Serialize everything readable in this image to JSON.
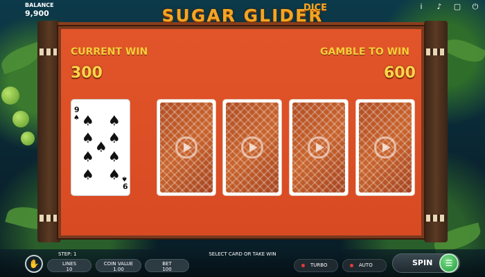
{
  "title": {
    "main": "SUGAR GLIDER",
    "sub": "DICE"
  },
  "balance": {
    "label": "BALANCE",
    "value": "9,900"
  },
  "top_icons": [
    "info-icon",
    "sound-icon",
    "fullscreen-icon",
    "power-icon"
  ],
  "gamble": {
    "current_win_label": "CURRENT WIN",
    "current_win_value": "300",
    "gamble_to_win_label": "GAMBLE TO WIN",
    "gamble_to_win_value": "600",
    "dealer_card": {
      "rank": "9",
      "suit": "spades"
    },
    "hidden_cards": 4
  },
  "bottom": {
    "step_label": "STEP: 1",
    "hint": "SELECT CARD OR TAKE WIN",
    "lines": {
      "label": "LINES",
      "value": "10"
    },
    "coin_value": {
      "label": "COIN VALUE",
      "value": "1.00"
    },
    "bet": {
      "label": "BET",
      "value": "100"
    },
    "turbo_label": "TURBO",
    "auto_label": "AUTO",
    "spin_label": "SPIN"
  },
  "colors": {
    "board": "#e2552a",
    "title": "#f3a623",
    "win_numbers": "#ffd54a",
    "spin": "#2fae4a"
  }
}
